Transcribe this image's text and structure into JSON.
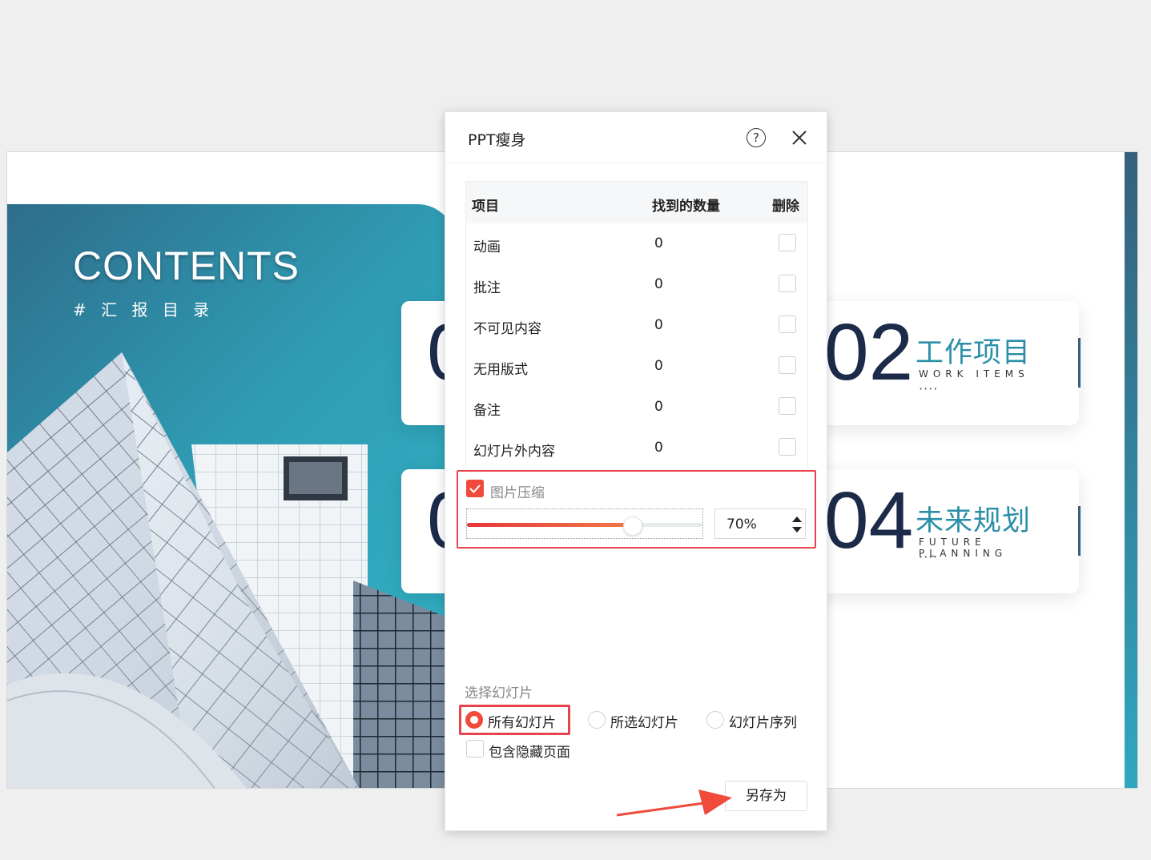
{
  "slide": {
    "contents_title": "CONTENTS",
    "contents_subtitle": "# 汇 报 目 录",
    "cards": [
      {
        "number": "0",
        "cn": "",
        "en": "",
        "dots": ""
      },
      {
        "number": "02",
        "cn": "工作项目",
        "en": "WORK ITEMS",
        "dots": "····"
      },
      {
        "number": "0",
        "cn": "",
        "en": "",
        "dots": ""
      },
      {
        "number": "04",
        "cn": "未来规划",
        "en": "FUTURE PLANNING",
        "dots": "····"
      }
    ]
  },
  "dialog": {
    "title": "PPT瘦身",
    "help_label": "?",
    "table": {
      "headers": {
        "item": "项目",
        "count": "找到的数量",
        "delete": "删除"
      },
      "rows": [
        {
          "name": "动画",
          "count": "0"
        },
        {
          "name": "批注",
          "count": "0"
        },
        {
          "name": "不可见内容",
          "count": "0"
        },
        {
          "name": "无用版式",
          "count": "0"
        },
        {
          "name": "备注",
          "count": "0"
        },
        {
          "name": "幻灯片外内容",
          "count": "0"
        }
      ]
    },
    "image_compress": {
      "label": "图片压缩",
      "checked": true,
      "value_text": "70%",
      "slider_fraction": 0.7
    },
    "select_slides": {
      "label": "选择幻灯片",
      "options": [
        "所有幻灯片",
        "所选幻灯片",
        "幻灯片序列"
      ],
      "selected": "所有幻灯片",
      "include_hidden": "包含隐藏页面"
    },
    "save_as_label": "另存为"
  },
  "colors": {
    "accent_red": "#ef4a3c",
    "highlight_border": "#e8424a",
    "teal": "#2b8fa8",
    "navy": "#1d2b4a"
  }
}
